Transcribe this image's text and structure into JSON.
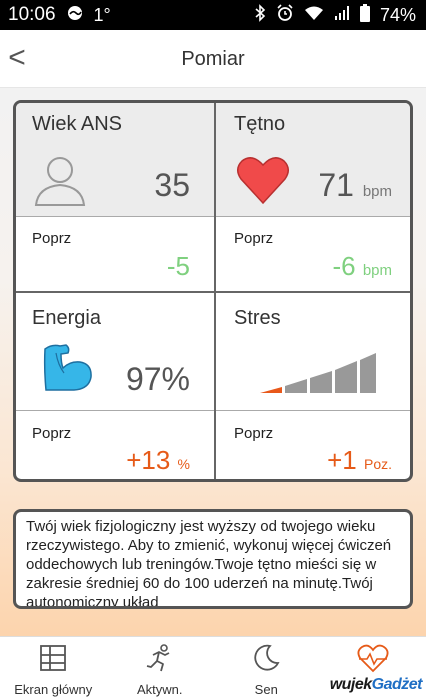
{
  "status_bar": {
    "time": "10:06",
    "temperature": "1°",
    "battery": "74%",
    "icons": [
      "weather-icon",
      "bluetooth-icon",
      "alarm-icon",
      "wifi-icon",
      "signal-icon",
      "battery-icon"
    ]
  },
  "header": {
    "back": "<",
    "title": "Pomiar"
  },
  "metrics": {
    "ans": {
      "label": "Wiek ANS",
      "value": "35",
      "icon": "person-icon",
      "prev_label": "Poprz",
      "delta": "-5",
      "delta_color": "#7fd07f"
    },
    "heart": {
      "label": "Tętno",
      "value": "71",
      "unit": "bpm",
      "icon": "heart-icon",
      "prev_label": "Poprz",
      "delta": "-6",
      "delta_unit": "bpm",
      "delta_color": "#7fd07f"
    },
    "energy": {
      "label": "Energia",
      "value": "97%",
      "icon": "flexed-arm-icon",
      "prev_label": "Poprz",
      "delta": "+13",
      "delta_unit": "%",
      "delta_color": "#e65a18"
    },
    "stress": {
      "label": "Stres",
      "icon": "stress-level-bars-icon",
      "level_filled": 1,
      "level_total": 5,
      "prev_label": "Poprz",
      "delta": "+1",
      "delta_unit": "Poz.",
      "delta_color": "#e65a18"
    }
  },
  "info": {
    "text": "Twój wiek fizjologiczny jest wyższy od twojego wieku rzeczywistego. Aby to zmienić, wykonuj więcej ćwiczeń oddechowych lub treningów.Twoje tętno mieści się w zakresie średniej 60 do 100 uderzeń na minutę.Twój autonomiczny układ"
  },
  "tabs": [
    {
      "label": "Ekran główny",
      "icon": "home-panels-icon"
    },
    {
      "label": "Aktywn.",
      "icon": "running-person-icon"
    },
    {
      "label": "Sen",
      "icon": "moon-icon"
    },
    {
      "label": "",
      "icon": "heart-pulse-icon",
      "active": true
    }
  ],
  "watermark": {
    "part1": "wujek",
    "part2": "Gadżet"
  },
  "colors": {
    "accent_orange": "#e65a18",
    "accent_green": "#7fd07f",
    "heart_red": "#f04a4a",
    "arm_blue": "#36b6e8"
  }
}
